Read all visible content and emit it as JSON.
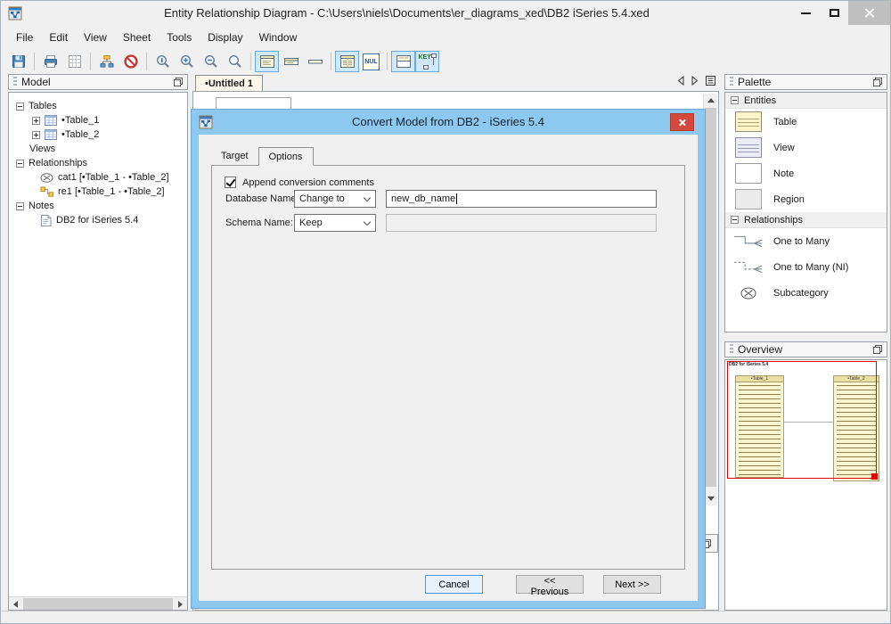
{
  "window": {
    "title": "Entity Relationship Diagram - C:\\Users\\niels\\Documents\\er_diagrams_xed\\DB2 iSeries 5.4.xed"
  },
  "menubar": [
    "File",
    "Edit",
    "View",
    "Sheet",
    "Tools",
    "Display",
    "Window"
  ],
  "toolbar": {
    "nul_label": "NUL",
    "key_label": "KEY",
    "icon_names": [
      "save",
      "print",
      "new-grid",
      "auto-layout",
      "no-entry",
      "zoom-actual",
      "zoom-in",
      "zoom-out",
      "zoom",
      "entity-full-view",
      "entity-compact-view",
      "entity-name-only-view",
      "show-columns",
      "show-nullability",
      "show-compartments",
      "show-keys"
    ]
  },
  "model_panel": {
    "title": "Model",
    "tree": [
      {
        "label": "Tables"
      },
      {
        "label": "•Table_1"
      },
      {
        "label": "•Table_2"
      },
      {
        "label": "Views"
      },
      {
        "label": "Relationships"
      },
      {
        "label": "cat1 [•Table_1 - •Table_2]"
      },
      {
        "label": "re1 [•Table_1 - •Table_2]"
      },
      {
        "label": "Notes"
      },
      {
        "label": "DB2 for iSeries 5.4"
      }
    ]
  },
  "editor": {
    "tab_label": "•Untitled 1"
  },
  "dialog": {
    "title": "Convert Model from DB2 - iSeries 5.4",
    "tabs": [
      {
        "label": "Target"
      },
      {
        "label": "Options"
      }
    ],
    "options_tab": {
      "append_comments_label": "Append conversion comments",
      "append_comments_checked": true,
      "database_name_label": "Database Name:",
      "database_name_mode": "Change to",
      "database_name_value": "new_db_name",
      "schema_name_label": "Schema Name:",
      "schema_name_mode": "Keep",
      "schema_name_value": ""
    },
    "buttons": {
      "cancel": "Cancel",
      "previous": "<< Previous",
      "next": "Next >>"
    }
  },
  "palette": {
    "title": "Palette",
    "sections": [
      {
        "label": "Entities",
        "items": [
          {
            "label": "Table",
            "icon": "table-entity"
          },
          {
            "label": "View",
            "icon": "view-entity"
          },
          {
            "label": "Note",
            "icon": "note-entity"
          },
          {
            "label": "Region",
            "icon": "region-entity"
          }
        ]
      },
      {
        "label": "Relationships",
        "items": [
          {
            "label": "One to Many",
            "icon": "one-to-many"
          },
          {
            "label": "One to Many (NI)",
            "icon": "one-to-many-ni"
          },
          {
            "label": "Subcategory",
            "icon": "subcategory"
          }
        ]
      }
    ]
  },
  "overview": {
    "title": "Overview",
    "note_label": "DB2 for iSeries 5.4",
    "tables": [
      "•Table_1",
      "•Table_2"
    ]
  },
  "colors": {
    "dialog_accent": "#8dc8f1",
    "close_button_red": "#d2483d",
    "toolbar_selected_bg": "#cfe8fa",
    "toolbar_selected_border": "#69a8dd",
    "viewport_red": "#e00000",
    "entity_yellow": "#fcf6d0"
  }
}
